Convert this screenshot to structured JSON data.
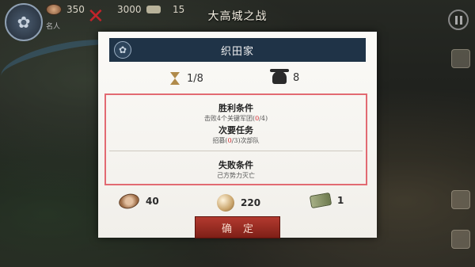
{
  "hud": {
    "gold": "350",
    "food": "3000",
    "troops": "15",
    "label_small": "名人",
    "colors": {
      "close_red": "#c2242a"
    }
  },
  "dialog": {
    "title": "大高城之战",
    "clan_name": "织田家",
    "turns": "1/8",
    "armies": "8",
    "conditions": {
      "victory_heading": "胜利条件",
      "victory_text_pre": "击败4个关键军团(",
      "victory_progress": "0",
      "victory_text_post": "/4)",
      "secondary_heading": "次要任务",
      "secondary_text_pre": "招募(",
      "secondary_progress": "0",
      "secondary_text_post": "/3)次部队",
      "defeat_heading": "失败条件",
      "defeat_text": "己方势力灭亡"
    },
    "rewards": {
      "gold": "40",
      "food": "220",
      "items": "1"
    },
    "confirm_label": "确定"
  }
}
